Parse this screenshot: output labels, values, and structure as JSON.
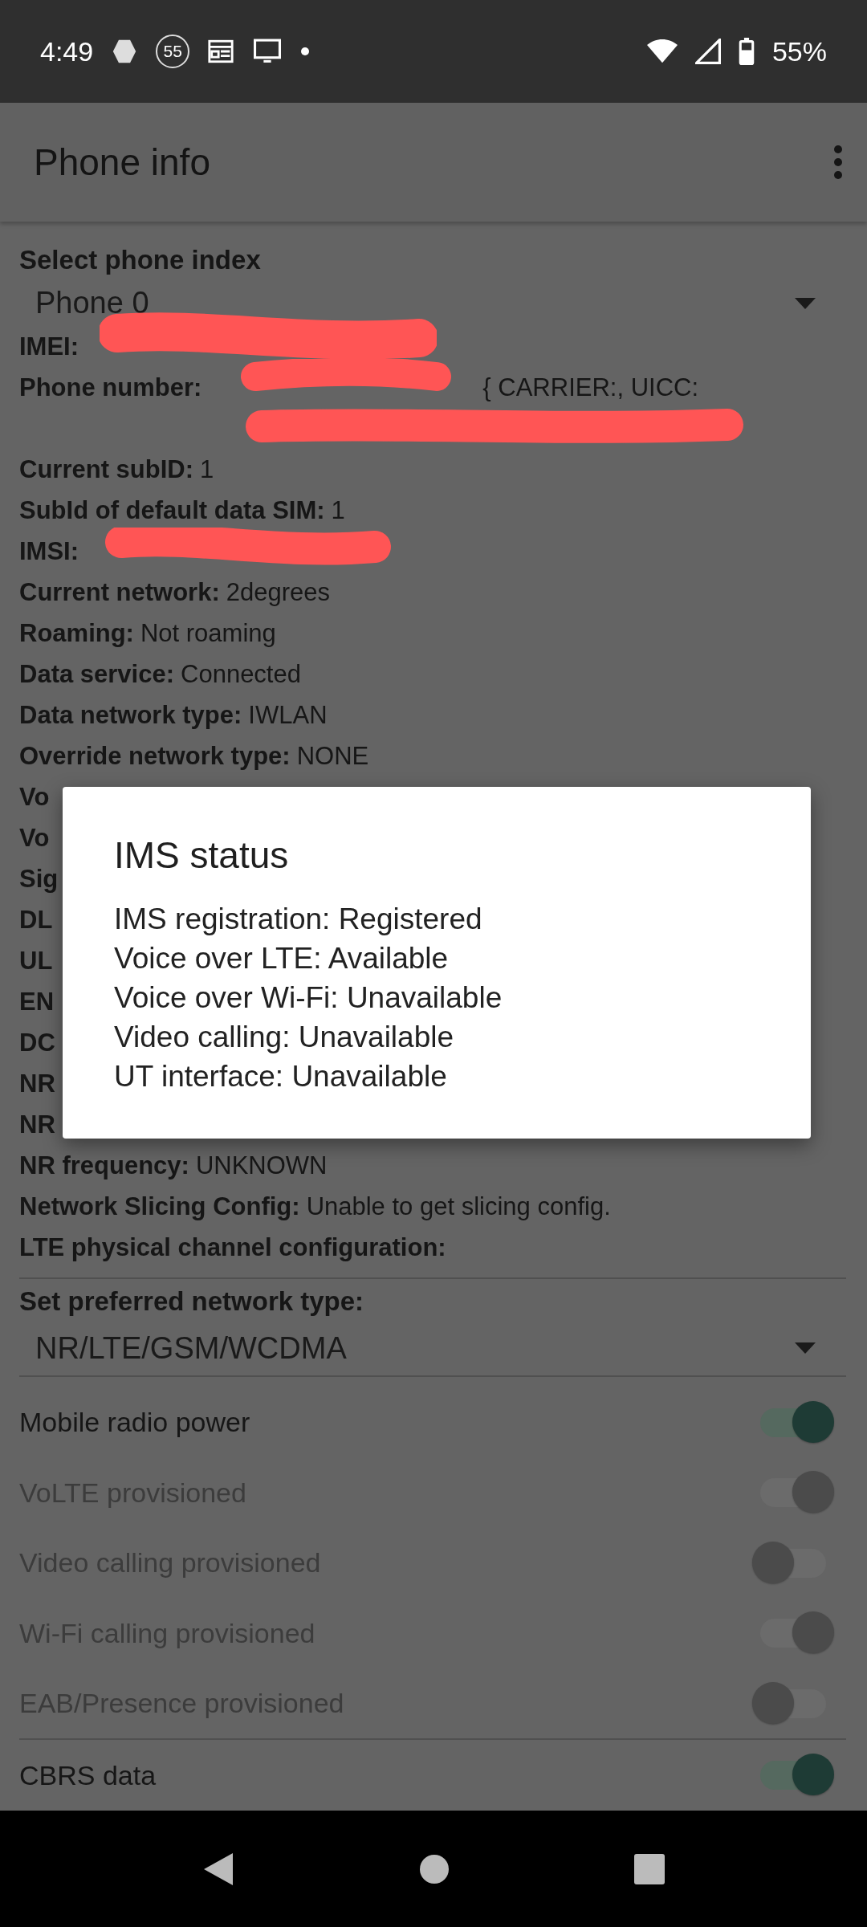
{
  "status_bar": {
    "time": "4:49",
    "badge_number": "55",
    "battery": "55%"
  },
  "app_bar": {
    "title": "Phone info"
  },
  "phone_index": {
    "label": "Select phone index",
    "value": "Phone 0"
  },
  "info_rows": [
    {
      "label": "IMEI:",
      "redacted": true
    },
    {
      "label": "Phone number:",
      "redacted": true,
      "value": "{ CARRIER:, UICC:",
      "wraps": true
    },
    {
      "label": "Current subID:",
      "value": "1"
    },
    {
      "label": "SubId of default data SIM:",
      "value": "1"
    },
    {
      "label": "IMSI:",
      "redacted": true
    },
    {
      "label": "Current network:",
      "value": "2degrees"
    },
    {
      "label": "Roaming:",
      "value": "Not roaming"
    },
    {
      "label": "Data service:",
      "value": "Connected"
    },
    {
      "label": "Data network type:",
      "value": "IWLAN"
    },
    {
      "label": "Override network type:",
      "value": "NONE"
    },
    {
      "label": "Vo"
    },
    {
      "label": "Vo"
    },
    {
      "label": "Sig"
    },
    {
      "label": "DL"
    },
    {
      "label": "UL"
    },
    {
      "label": "EN"
    },
    {
      "label": "DC"
    },
    {
      "label": "NR"
    },
    {
      "label": "NR"
    },
    {
      "label": "NR frequency:",
      "value": "UNKNOWN"
    },
    {
      "label": "Network Slicing Config:",
      "value": "Unable to get slicing config."
    },
    {
      "label": "LTE physical channel configuration:"
    }
  ],
  "preferred_network": {
    "label": "Set preferred network type:",
    "value": "NR/LTE/GSM/WCDMA"
  },
  "switches": [
    {
      "label": "Mobile radio power",
      "on": true,
      "disabled": false
    },
    {
      "label": "VoLTE provisioned",
      "on": true,
      "disabled": true
    },
    {
      "label": "Video calling provisioned",
      "on": false,
      "disabled": true
    },
    {
      "label": "Wi-Fi calling provisioned",
      "on": true,
      "disabled": true
    },
    {
      "label": "EAB/Presence provisioned",
      "on": false,
      "disabled": true,
      "divider": true
    },
    {
      "label": "CBRS data",
      "on": true,
      "disabled": false
    }
  ],
  "dialog": {
    "title": "IMS status",
    "lines": [
      "IMS registration: Registered",
      "Voice over LTE: Available",
      "Voice over Wi-Fi: Unavailable",
      "Video calling: Unavailable",
      "UT interface: Unavailable"
    ]
  }
}
